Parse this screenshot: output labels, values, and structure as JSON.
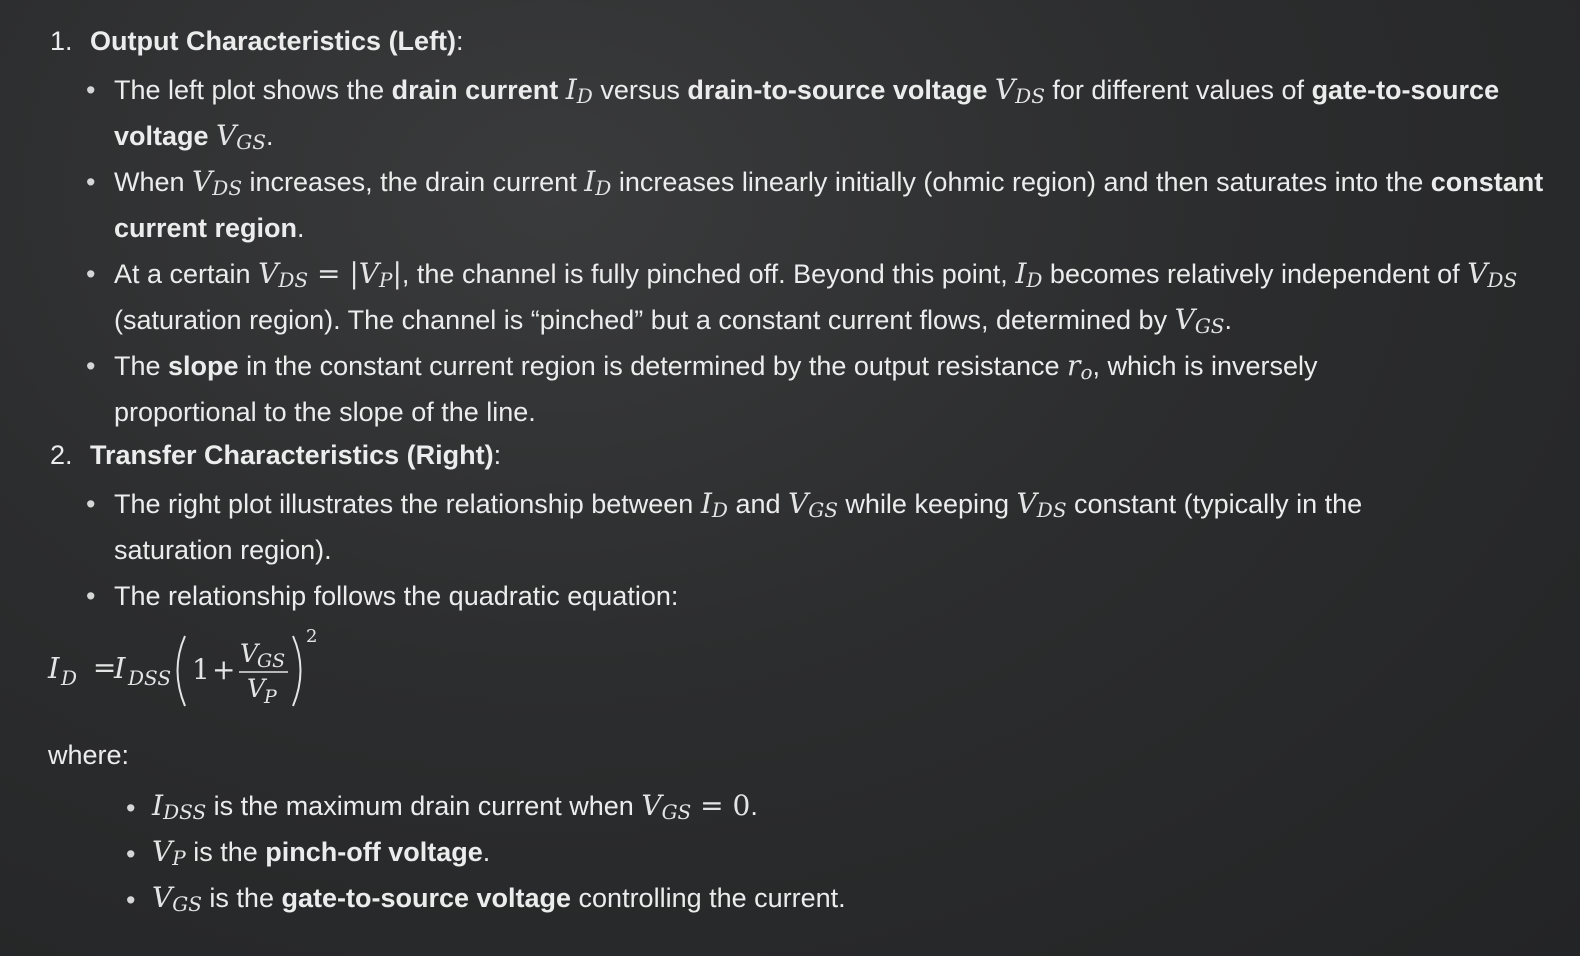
{
  "sections": [
    {
      "number": "1.",
      "title": "Output Characteristics (Left)",
      "colon": ":"
    },
    {
      "number": "2.",
      "title": "Transfer Characteristics (Right)",
      "colon": ":"
    }
  ],
  "s1": {
    "b1": {
      "t1": "The left plot shows the ",
      "bold1": "drain current",
      "t2": " versus ",
      "bold2": "drain-to-source voltage",
      "t3": " for different values of ",
      "bold3": "gate-to-source voltage",
      "t4": "."
    },
    "b2": {
      "t1": "When ",
      "t2": " increases, the drain current ",
      "t3": " increases linearly initially (ohmic region) and then saturates into the ",
      "bold1": "constant current region",
      "t4": "."
    },
    "b3": {
      "t1": "At a certain ",
      "t2": ", the channel is fully pinched off. Beyond this point, ",
      "t3": " becomes relatively independent of ",
      "t4": " (saturation region). The channel is “pinched” but a constant current flows, determined by ",
      "t5": "."
    },
    "b4": {
      "t1": "The ",
      "bold1": "slope",
      "t2": " in the constant current region is determined by the output resistance ",
      "t3": ", which is inversely proportional to the slope of the line."
    }
  },
  "s2": {
    "b1": {
      "t1": "The right plot illustrates the relationship between ",
      "t2": " and ",
      "t3": " while keeping ",
      "t4": " constant (typically in the saturation region)."
    },
    "b2": {
      "t1": "The relationship follows the quadratic equation:"
    }
  },
  "math": {
    "I": "I",
    "V": "V",
    "r": "r",
    "D": "D",
    "DS": "DS",
    "GS": "GS",
    "P": "P",
    "DSS": "DSS",
    "o": "o",
    "eq": " = ",
    "bar": "|",
    "zero": "0",
    "one": "1",
    "plus": "+",
    "two": "2"
  },
  "where": {
    "label": "where:",
    "items": [
      {
        "t1": " is the maximum drain current when ",
        "t2": "."
      },
      {
        "t1": " is the ",
        "bold": "pinch-off voltage",
        "t2": "."
      },
      {
        "t1": " is the ",
        "bold": "gate-to-source voltage",
        "t2": " controlling the current."
      }
    ]
  }
}
